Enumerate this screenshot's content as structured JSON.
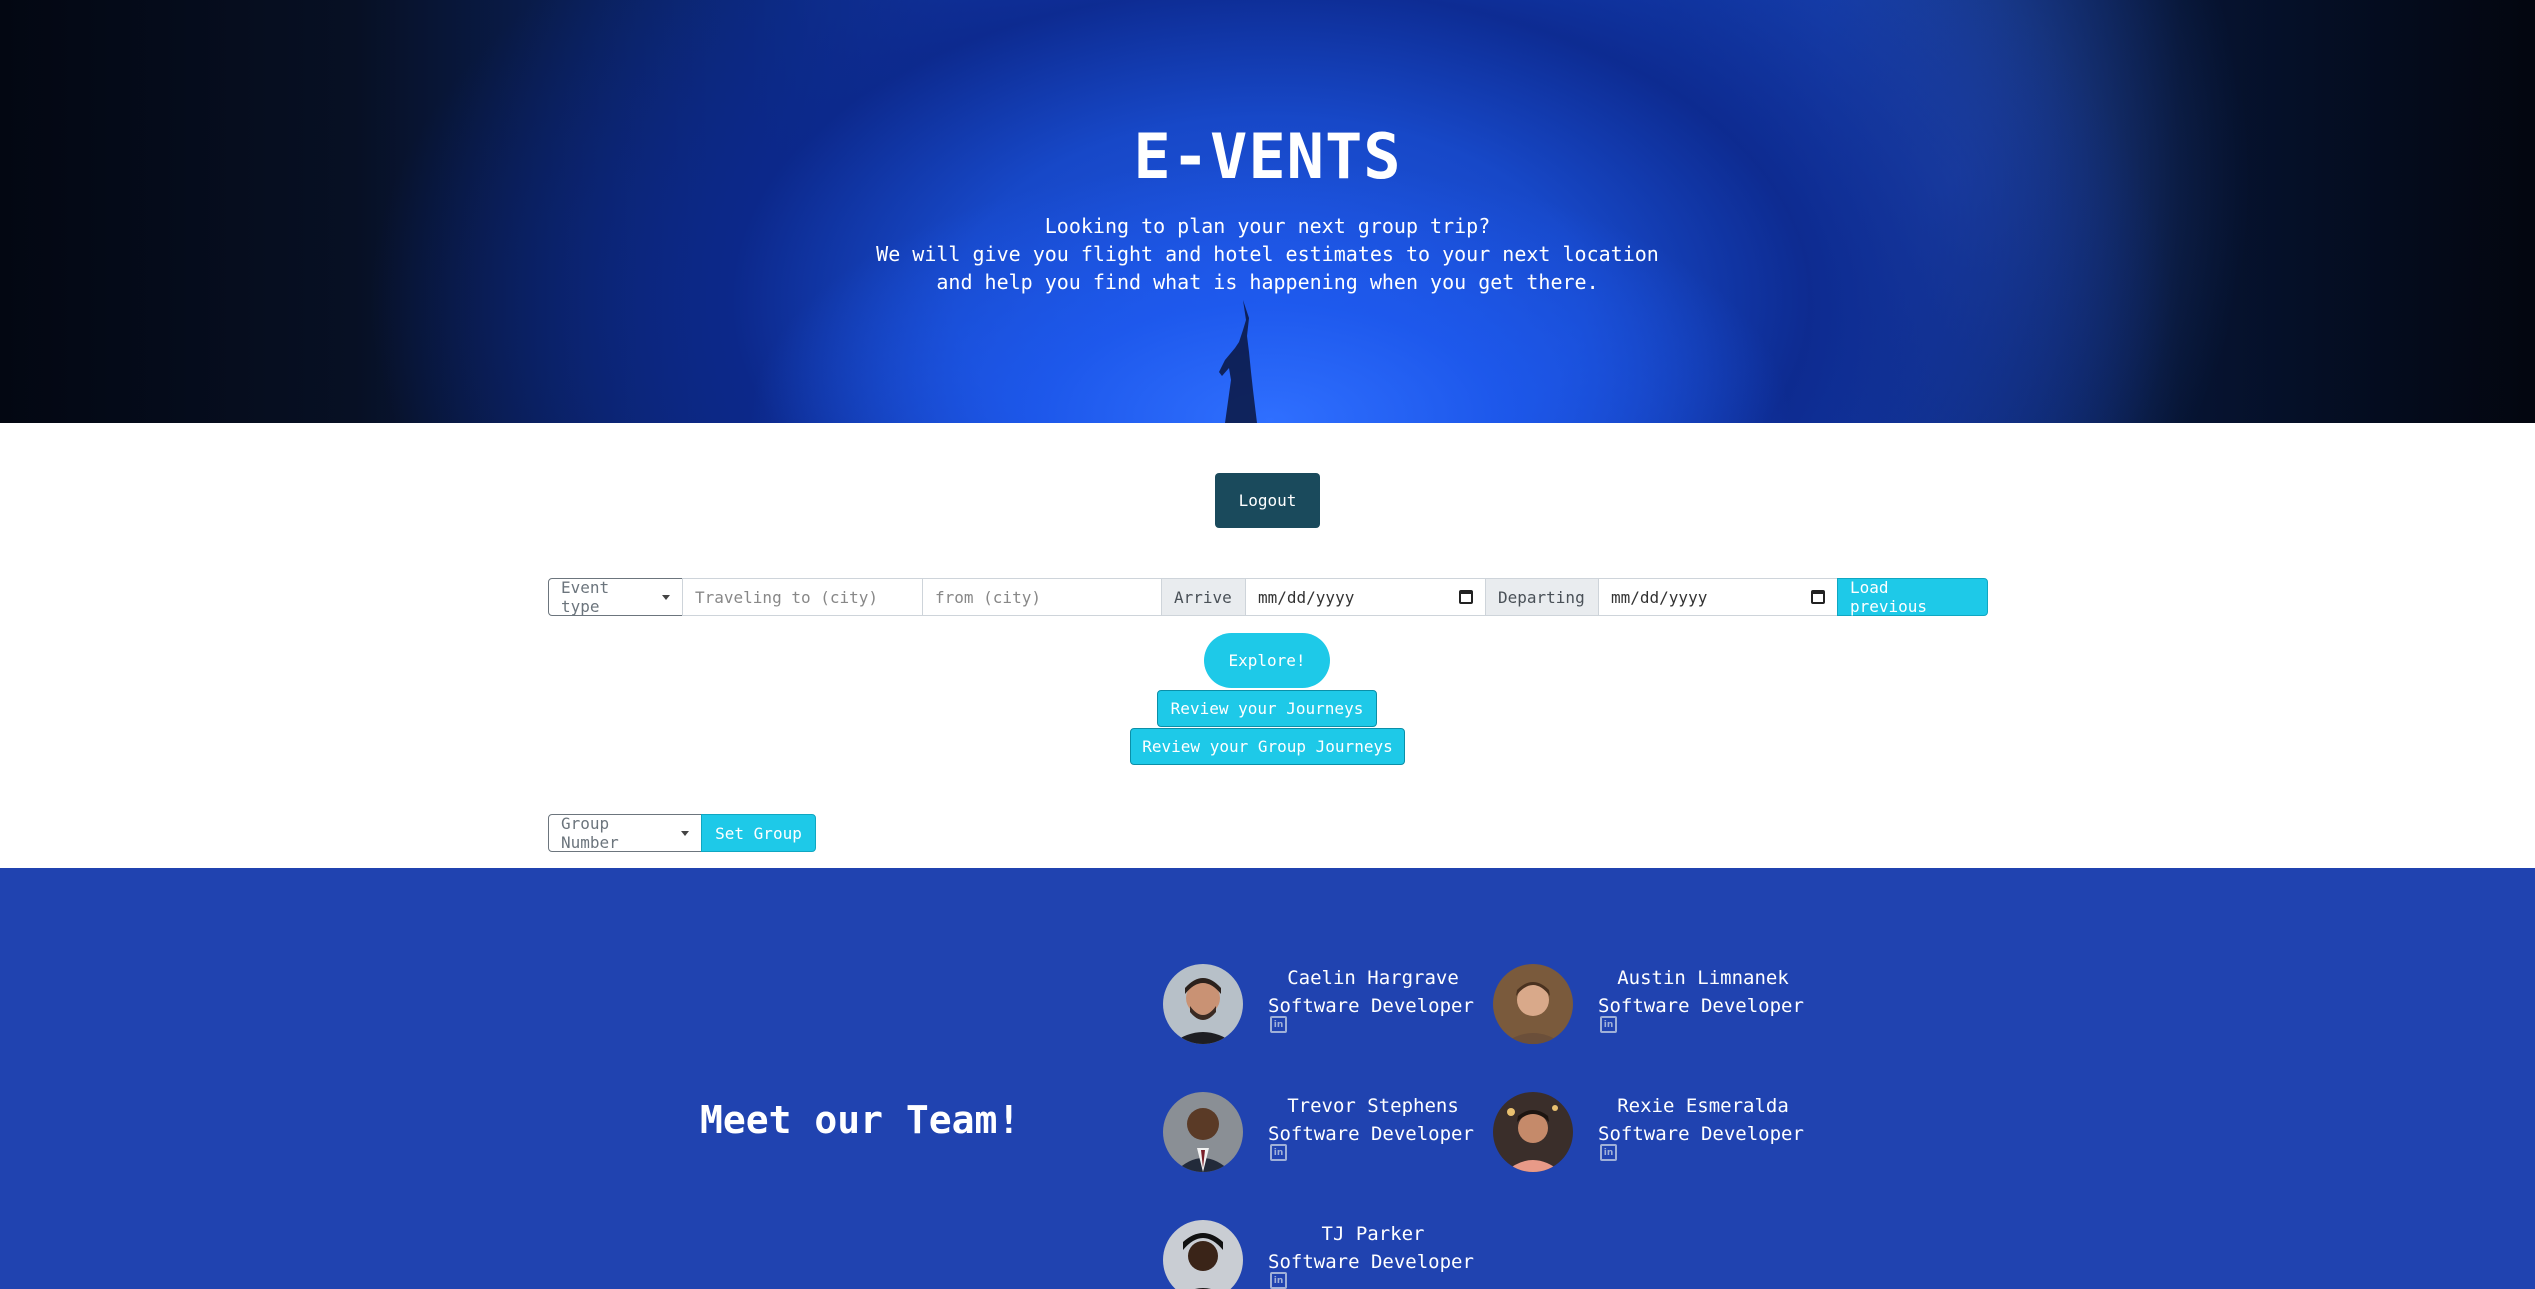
{
  "hero": {
    "title": "E-VENTS",
    "subtitle_lines": [
      "Looking to plan your next group trip?",
      "We will give you flight and hotel estimates to your next location",
      "and help you find what is happening when you get there."
    ]
  },
  "actions": {
    "logout": "Logout",
    "explore": "Explore!",
    "review_journeys": "Review your Journeys",
    "review_group_journeys": "Review your Group Journeys"
  },
  "search": {
    "event_type": "Event type",
    "to_city_placeholder": "Traveling to (city)",
    "from_city_placeholder": "from (city)",
    "arrive_label": "Arrive",
    "arrive_value": "mm/dd/yyyy",
    "departing_label": "Departing",
    "departing_value": "mm/dd/yyyy",
    "load_previous": "Load previous"
  },
  "group": {
    "group_number": "Group Number",
    "set_group": "Set Group"
  },
  "team": {
    "title": "Meet our Team!",
    "members": [
      {
        "name": "Caelin Hargrave",
        "role": "Software Developer"
      },
      {
        "name": "Austin Limnanek",
        "role": "Software Developer"
      },
      {
        "name": "Trevor Stephens",
        "role": "Software Developer"
      },
      {
        "name": "Rexie Esmeralda",
        "role": "Software Developer"
      },
      {
        "name": "TJ Parker",
        "role": "Software Developer"
      }
    ],
    "social_icon": "linkedin-icon"
  },
  "colors": {
    "accent": "#1ec9e8",
    "logout": "#1a4a5c",
    "team_bg": "#2043b0"
  }
}
